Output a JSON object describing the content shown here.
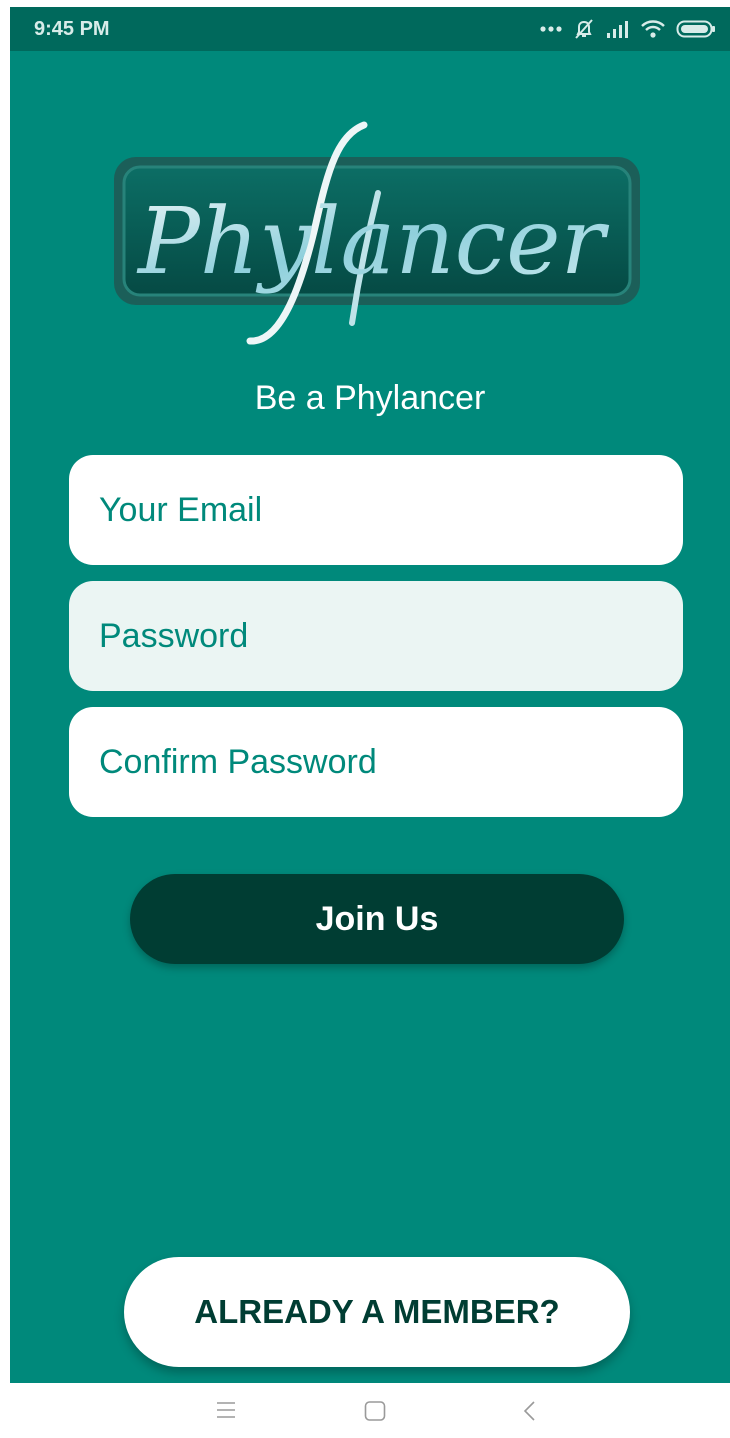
{
  "status_bar": {
    "time": "9:45 PM",
    "icons": [
      "more-dots-icon",
      "notifications-off-icon",
      "signal-icon",
      "wifi-icon",
      "battery-icon"
    ]
  },
  "logo": {
    "text": "Phylancer"
  },
  "tagline": "Be a Phylancer",
  "form": {
    "email_placeholder": "Your Email",
    "password_placeholder": "Password",
    "confirm_placeholder": "Confirm Password",
    "join_label": "Join Us"
  },
  "footer": {
    "member_label": "ALREADY A MEMBER?"
  },
  "nav_bar": {
    "icons": [
      "menu-icon",
      "home-icon",
      "back-icon"
    ]
  },
  "colors": {
    "background": "#00897b",
    "status_bar": "#00695c",
    "button_dark": "#003d33",
    "field": "#ffffff",
    "field_focused": "#ebf5f3"
  }
}
